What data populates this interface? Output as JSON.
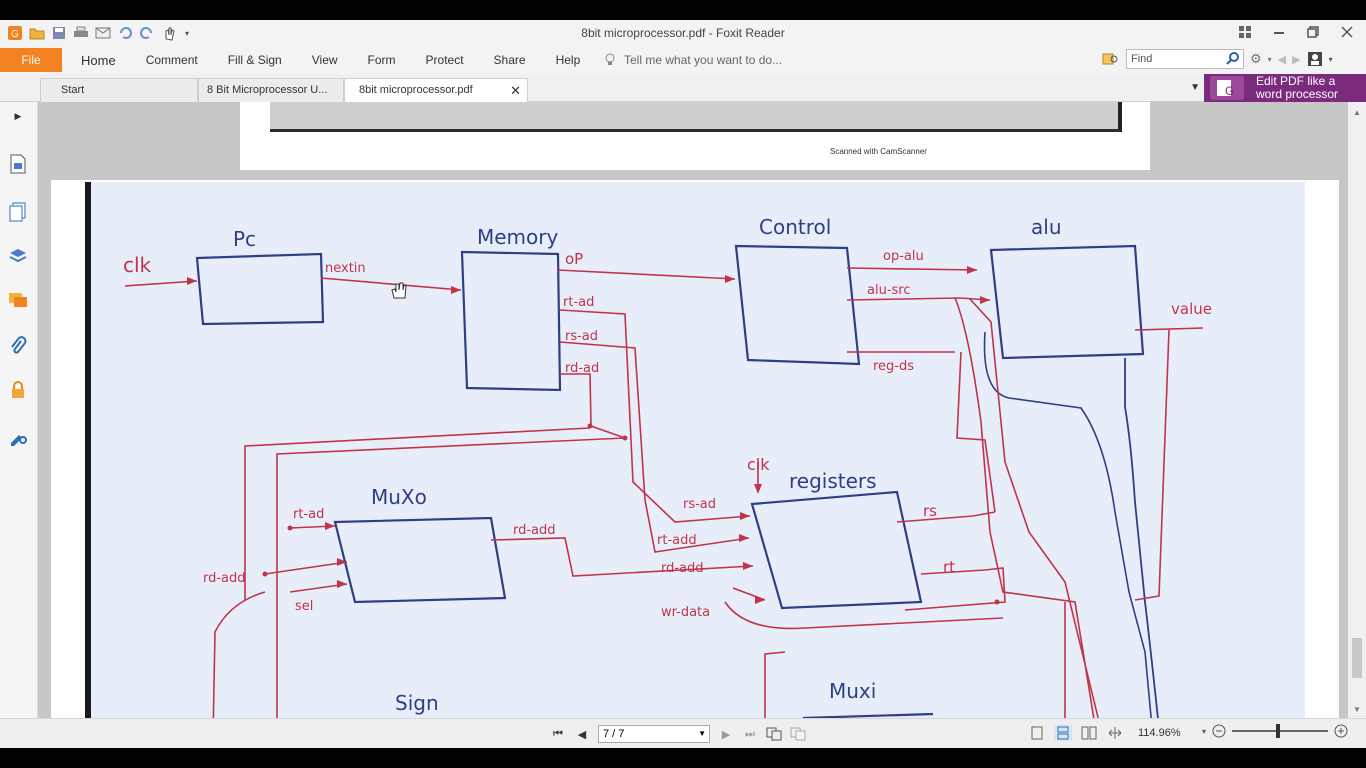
{
  "app": {
    "title": "8bit microprocessor.pdf - Foxit Reader"
  },
  "ribbon": {
    "file": "File",
    "menu": [
      "Home",
      "Comment",
      "Fill & Sign",
      "View",
      "Form",
      "Protect",
      "Share",
      "Help"
    ],
    "tell_me": "Tell me what you want to do...",
    "find_placeholder": "Find"
  },
  "tabs": [
    {
      "label": "Start"
    },
    {
      "label": "8 Bit Microprocessor U..."
    },
    {
      "label": "8bit microprocessor.pdf",
      "active": true
    }
  ],
  "promo": {
    "line1": "Edit PDF like a",
    "line2": "word processor"
  },
  "previous_page": {
    "footer": "Scanned with CamScanner"
  },
  "diagram": {
    "blocks": [
      "Pc",
      "Memory",
      "Control",
      "alu",
      "MuXo",
      "registers",
      "Muxi"
    ],
    "labels": {
      "clk_in": "clk",
      "pc_out": "nextin",
      "mem_op": "oP",
      "mem_rt": "rt-ad",
      "mem_rs": "rs-ad",
      "mem_rd": "rd-ad",
      "ctrl_opalu": "op-alu",
      "ctrl_alusrc": "alu-src",
      "ctrl_regds": "reg-ds",
      "alu_out": "value",
      "mux_rt": "rt-ad",
      "mux_rd": "rd-add",
      "mux_sel": "sel",
      "mux_out": "rd-add",
      "reg_clk": "clk",
      "reg_rs": "rs-ad",
      "reg_rt": "rt-add",
      "reg_rd": "rd-add",
      "reg_wd": "wr-data",
      "reg_out_rs": "rs",
      "reg_out_rt": "rt",
      "sign": "Sign"
    }
  },
  "status": {
    "page": "7 / 7",
    "zoom": "114.96%"
  },
  "colors": {
    "accent": "#f58220",
    "promo": "#7c2a7d",
    "ink_red": "#c0344a",
    "ink_blue": "#2f3f86"
  },
  "icons": {
    "quick_access": [
      "app-logo-icon",
      "open-icon",
      "save-icon",
      "print-icon",
      "email-icon",
      "undo-icon",
      "redo-icon",
      "hand-tool-icon"
    ],
    "sidebar": [
      "page-thumbnail-icon",
      "pages-icon",
      "layers-icon",
      "comments-icon",
      "attachments-icon",
      "security-icon",
      "signatures-icon"
    ]
  }
}
